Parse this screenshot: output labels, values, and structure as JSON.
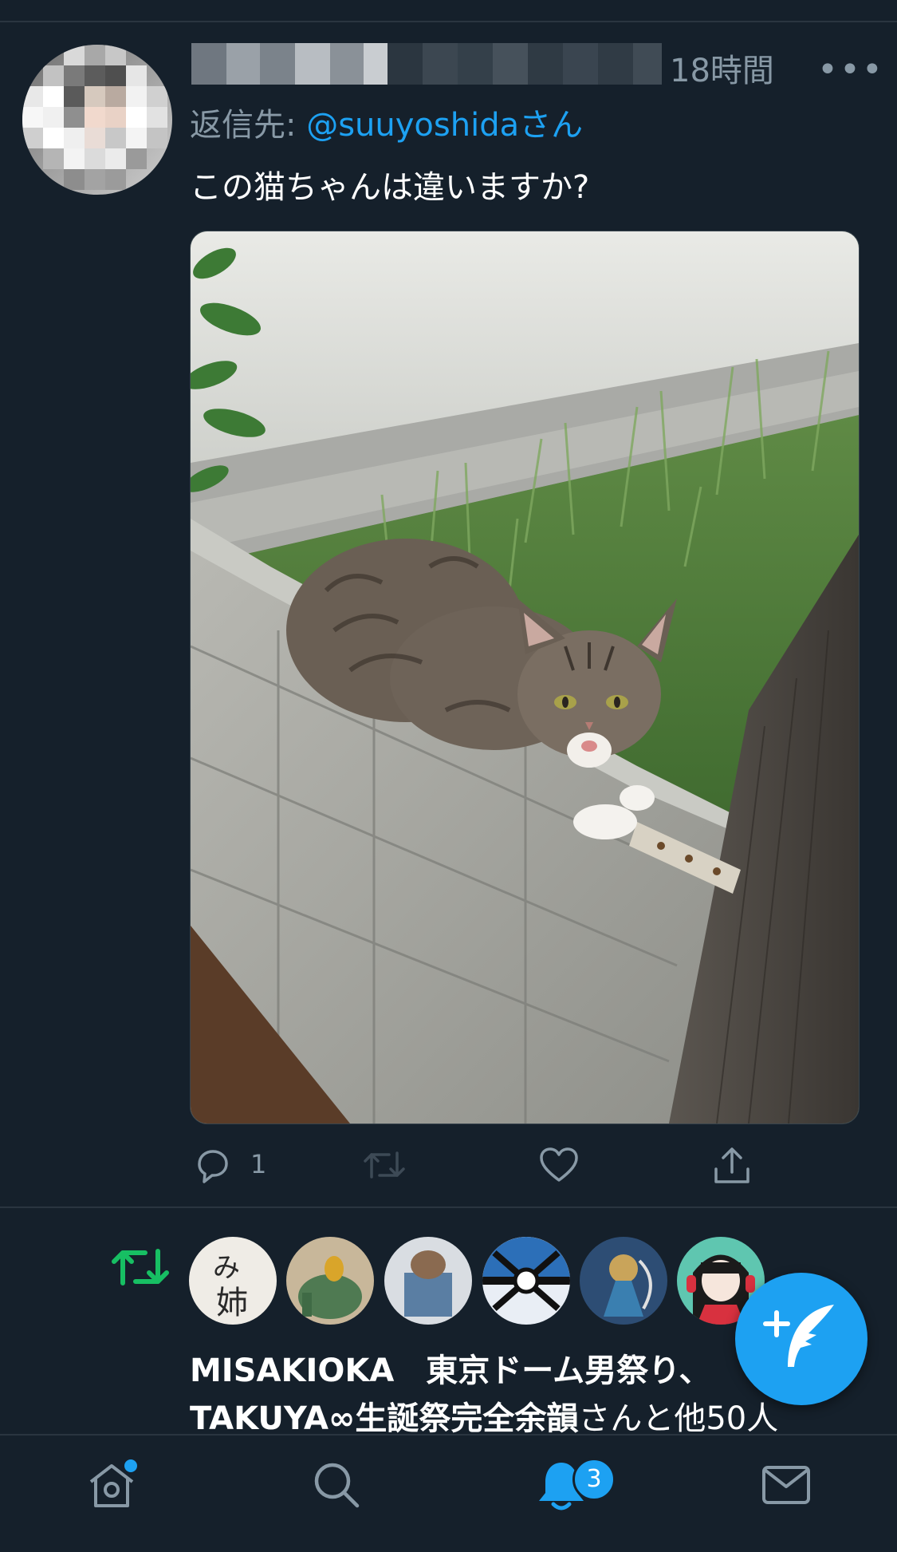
{
  "tweet": {
    "time": "18時間",
    "more_label": "•••",
    "reply_prefix": "返信先: ",
    "reply_handle": "@suuyoshidaさん",
    "text": "この猫ちゃんは違いますか?",
    "reply_count": "1"
  },
  "notification": {
    "names_bold": "MISAKIOKA　東京ドーム男祭り、TAKUYA∞生誕祭完全余韻",
    "suffix": "さんと他50人"
  },
  "bottom_nav": {
    "notifications_badge": "3"
  },
  "colors": {
    "background": "#15202b",
    "accent": "#1da1f2",
    "muted": "#8899a6",
    "retweet_green": "#17bf63"
  },
  "icons": [
    "reply-icon",
    "retweet-icon",
    "like-icon",
    "share-icon",
    "compose-icon",
    "home-icon",
    "search-icon",
    "bell-icon",
    "mail-icon"
  ]
}
